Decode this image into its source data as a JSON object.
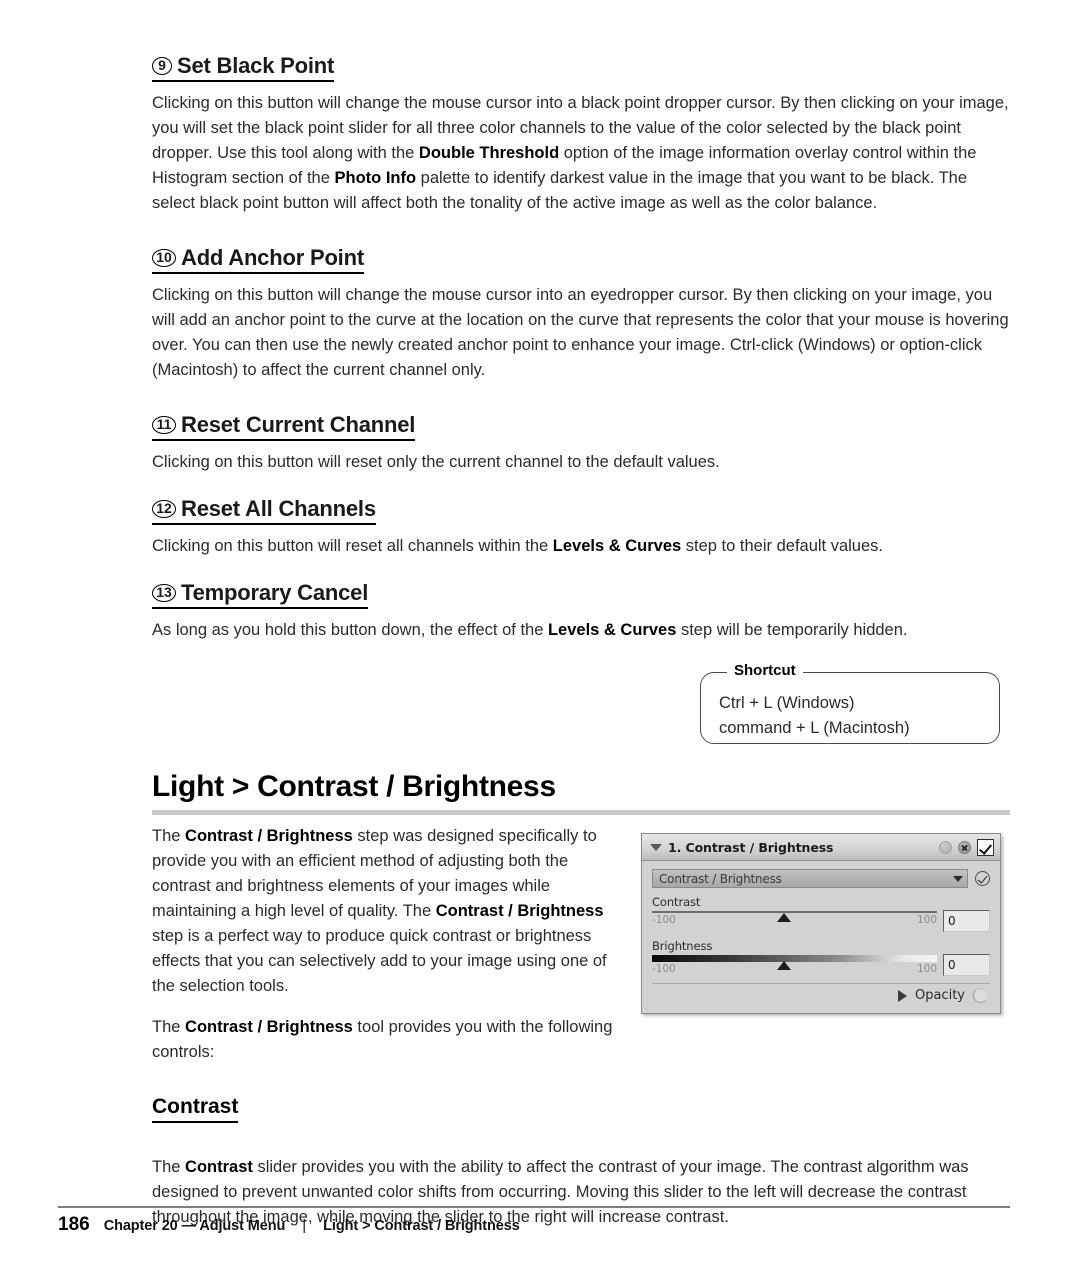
{
  "sections": [
    {
      "number": "9",
      "title": "Set Black Point",
      "paragraph_html": "Clicking on this button will change the mouse cursor into a black point dropper cursor. By then clicking on your image, you will set the black point slider for all three color channels to the value of the color selected by the black point dropper. Use this tool along with the <b>Double Threshold</b> option of the image information overlay control within the Histogram section of the <b>Photo Info</b> palette to identify darkest value in the image that you want to be black. The select black point button will affect both the tonality of the active image as well as the color balance."
    },
    {
      "number": "10",
      "title": "Add Anchor Point",
      "paragraph_html": "Clicking on this button will change the mouse cursor into an eyedropper cursor. By then clicking on your image, you will add an anchor point to the curve at the location on the curve that represents the color that your mouse is hovering over. You can then use the newly created anchor point to enhance your image. Ctrl-click (Windows) or option-click (Macintosh) to affect the current channel only."
    },
    {
      "number": "11",
      "title": "Reset Current Channel",
      "paragraph_html": "Clicking on this button will reset only the current channel to the default values."
    },
    {
      "number": "12",
      "title": "Reset All Channels",
      "paragraph_html": "Clicking on this button will reset all channels within the <b>Levels &amp; Curves</b> step to their default values."
    },
    {
      "number": "13",
      "title": "Temporary Cancel",
      "paragraph_html": "As long as you hold this button down, the effect of the <b>Levels &amp; Curves</b> step will be temporarily hidden."
    }
  ],
  "shortcut": {
    "legend": "Shortcut",
    "line1": "Ctrl + L (Windows)",
    "line2": "command + L (Macintosh)"
  },
  "section_heading": "Light > Contrast / Brightness",
  "lower": {
    "paragraph1_html": "The <b>Contrast / Brightness</b> step was designed specifically to provide you with an efficient method of adjusting both the contrast and brightness elements of your images while maintaining a high level of quality. The <b>Contrast / Brightness</b> step is a perfect way to produce quick contrast or brightness effects that you can selectively add to your image using one of the selection tools.",
    "paragraph2_html": "The <b>Contrast / Brightness</b> tool provides you with the following controls:"
  },
  "app_panel": {
    "title": "1. Contrast / Brightness",
    "dropdown_value": "Contrast / Brightness",
    "sliders": [
      {
        "label": "Contrast",
        "min": "-100",
        "max": "100",
        "value": "0",
        "style": "plain"
      },
      {
        "label": "Brightness",
        "min": "-100",
        "max": "100",
        "value": "0",
        "style": "gradient"
      }
    ],
    "opacity_label": "Opacity"
  },
  "sub_section": {
    "heading": "Contrast",
    "paragraph_html": "The <b>Contrast</b> slider provides you with the ability to affect the contrast of your image. The contrast algorithm was designed to prevent unwanted color shifts from occurring. Moving this slider to the left will decrease the contrast throughout the image, while moving the slider to the right will increase contrast."
  },
  "footer": {
    "page": "186",
    "chapter": "Chapter 20 — Adjust Menu",
    "separator": "|",
    "path": "Light > Contrast / Brightness"
  }
}
